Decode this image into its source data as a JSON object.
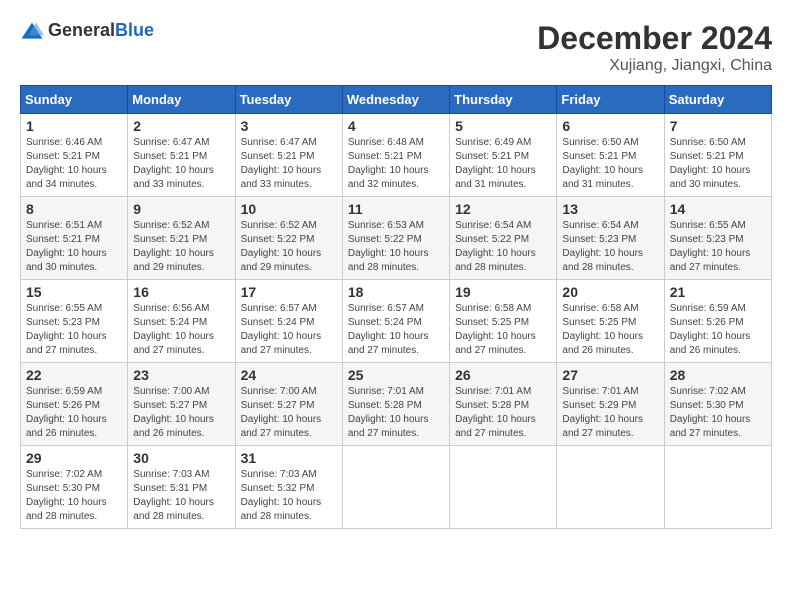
{
  "header": {
    "logo_general": "General",
    "logo_blue": "Blue",
    "main_title": "December 2024",
    "subtitle": "Xujiang, Jiangxi, China"
  },
  "weekdays": [
    "Sunday",
    "Monday",
    "Tuesday",
    "Wednesday",
    "Thursday",
    "Friday",
    "Saturday"
  ],
  "weeks": [
    [
      {
        "day": "1",
        "sunrise": "6:46 AM",
        "sunset": "5:21 PM",
        "daylight": "10 hours and 34 minutes."
      },
      {
        "day": "2",
        "sunrise": "6:47 AM",
        "sunset": "5:21 PM",
        "daylight": "10 hours and 33 minutes."
      },
      {
        "day": "3",
        "sunrise": "6:47 AM",
        "sunset": "5:21 PM",
        "daylight": "10 hours and 33 minutes."
      },
      {
        "day": "4",
        "sunrise": "6:48 AM",
        "sunset": "5:21 PM",
        "daylight": "10 hours and 32 minutes."
      },
      {
        "day": "5",
        "sunrise": "6:49 AM",
        "sunset": "5:21 PM",
        "daylight": "10 hours and 31 minutes."
      },
      {
        "day": "6",
        "sunrise": "6:50 AM",
        "sunset": "5:21 PM",
        "daylight": "10 hours and 31 minutes."
      },
      {
        "day": "7",
        "sunrise": "6:50 AM",
        "sunset": "5:21 PM",
        "daylight": "10 hours and 30 minutes."
      }
    ],
    [
      {
        "day": "8",
        "sunrise": "6:51 AM",
        "sunset": "5:21 PM",
        "daylight": "10 hours and 30 minutes."
      },
      {
        "day": "9",
        "sunrise": "6:52 AM",
        "sunset": "5:21 PM",
        "daylight": "10 hours and 29 minutes."
      },
      {
        "day": "10",
        "sunrise": "6:52 AM",
        "sunset": "5:22 PM",
        "daylight": "10 hours and 29 minutes."
      },
      {
        "day": "11",
        "sunrise": "6:53 AM",
        "sunset": "5:22 PM",
        "daylight": "10 hours and 28 minutes."
      },
      {
        "day": "12",
        "sunrise": "6:54 AM",
        "sunset": "5:22 PM",
        "daylight": "10 hours and 28 minutes."
      },
      {
        "day": "13",
        "sunrise": "6:54 AM",
        "sunset": "5:23 PM",
        "daylight": "10 hours and 28 minutes."
      },
      {
        "day": "14",
        "sunrise": "6:55 AM",
        "sunset": "5:23 PM",
        "daylight": "10 hours and 27 minutes."
      }
    ],
    [
      {
        "day": "15",
        "sunrise": "6:55 AM",
        "sunset": "5:23 PM",
        "daylight": "10 hours and 27 minutes."
      },
      {
        "day": "16",
        "sunrise": "6:56 AM",
        "sunset": "5:24 PM",
        "daylight": "10 hours and 27 minutes."
      },
      {
        "day": "17",
        "sunrise": "6:57 AM",
        "sunset": "5:24 PM",
        "daylight": "10 hours and 27 minutes."
      },
      {
        "day": "18",
        "sunrise": "6:57 AM",
        "sunset": "5:24 PM",
        "daylight": "10 hours and 27 minutes."
      },
      {
        "day": "19",
        "sunrise": "6:58 AM",
        "sunset": "5:25 PM",
        "daylight": "10 hours and 27 minutes."
      },
      {
        "day": "20",
        "sunrise": "6:58 AM",
        "sunset": "5:25 PM",
        "daylight": "10 hours and 26 minutes."
      },
      {
        "day": "21",
        "sunrise": "6:59 AM",
        "sunset": "5:26 PM",
        "daylight": "10 hours and 26 minutes."
      }
    ],
    [
      {
        "day": "22",
        "sunrise": "6:59 AM",
        "sunset": "5:26 PM",
        "daylight": "10 hours and 26 minutes."
      },
      {
        "day": "23",
        "sunrise": "7:00 AM",
        "sunset": "5:27 PM",
        "daylight": "10 hours and 26 minutes."
      },
      {
        "day": "24",
        "sunrise": "7:00 AM",
        "sunset": "5:27 PM",
        "daylight": "10 hours and 27 minutes."
      },
      {
        "day": "25",
        "sunrise": "7:01 AM",
        "sunset": "5:28 PM",
        "daylight": "10 hours and 27 minutes."
      },
      {
        "day": "26",
        "sunrise": "7:01 AM",
        "sunset": "5:28 PM",
        "daylight": "10 hours and 27 minutes."
      },
      {
        "day": "27",
        "sunrise": "7:01 AM",
        "sunset": "5:29 PM",
        "daylight": "10 hours and 27 minutes."
      },
      {
        "day": "28",
        "sunrise": "7:02 AM",
        "sunset": "5:30 PM",
        "daylight": "10 hours and 27 minutes."
      }
    ],
    [
      {
        "day": "29",
        "sunrise": "7:02 AM",
        "sunset": "5:30 PM",
        "daylight": "10 hours and 28 minutes."
      },
      {
        "day": "30",
        "sunrise": "7:03 AM",
        "sunset": "5:31 PM",
        "daylight": "10 hours and 28 minutes."
      },
      {
        "day": "31",
        "sunrise": "7:03 AM",
        "sunset": "5:32 PM",
        "daylight": "10 hours and 28 minutes."
      },
      null,
      null,
      null,
      null
    ]
  ]
}
